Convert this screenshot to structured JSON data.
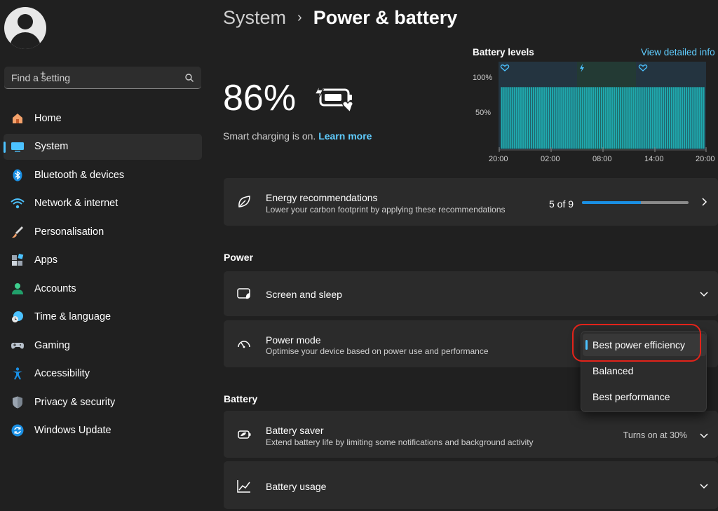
{
  "sidebar": {
    "search_placeholder": "Find a setting",
    "items": [
      {
        "label": "Home",
        "icon": "home-icon"
      },
      {
        "label": "System",
        "icon": "system-icon",
        "active": true
      },
      {
        "label": "Bluetooth & devices",
        "icon": "bluetooth-icon"
      },
      {
        "label": "Network & internet",
        "icon": "wifi-icon"
      },
      {
        "label": "Personalisation",
        "icon": "brush-icon"
      },
      {
        "label": "Apps",
        "icon": "apps-icon"
      },
      {
        "label": "Accounts",
        "icon": "accounts-icon"
      },
      {
        "label": "Time & language",
        "icon": "clock-globe-icon"
      },
      {
        "label": "Gaming",
        "icon": "gamepad-icon"
      },
      {
        "label": "Accessibility",
        "icon": "accessibility-icon"
      },
      {
        "label": "Privacy & security",
        "icon": "shield-icon"
      },
      {
        "label": "Windows Update",
        "icon": "update-icon"
      }
    ]
  },
  "breadcrumb": {
    "parent": "System",
    "separator": "›",
    "title": "Power & battery"
  },
  "battery": {
    "percent_text": "86%",
    "smart_text": "Smart charging is on.",
    "learn_more": "Learn more"
  },
  "levels": {
    "title": "Battery levels",
    "link": "View detailed info",
    "y_labels": [
      "100%",
      "50%"
    ],
    "x_labels": [
      "20:00",
      "02:00",
      "08:00",
      "14:00",
      "20:00"
    ]
  },
  "chart_data": {
    "type": "bar",
    "title": "Battery levels",
    "ylim": [
      0,
      100
    ],
    "y_ticks": [
      "100%",
      "50%"
    ],
    "x_ticks": [
      "20:00",
      "02:00",
      "08:00",
      "14:00",
      "20:00"
    ],
    "values": [
      86,
      86,
      86,
      86,
      86,
      86,
      86,
      86,
      86,
      86,
      86,
      86,
      86,
      86,
      86,
      86,
      86,
      86,
      86,
      86,
      86,
      86,
      86,
      86,
      86,
      86,
      86,
      86,
      86,
      86,
      86,
      86,
      86,
      86,
      86,
      86,
      86,
      86,
      86,
      86,
      86,
      86,
      86,
      86,
      86,
      86,
      86,
      86,
      86,
      86,
      86,
      86,
      86,
      86,
      86,
      86,
      86,
      86,
      86,
      86,
      86,
      86,
      86,
      86,
      86,
      86,
      86,
      86,
      86,
      86,
      86,
      86,
      86,
      86,
      86,
      86,
      86,
      86,
      86,
      86,
      86,
      86,
      86,
      86,
      86,
      86,
      86,
      86,
      86,
      86,
      86,
      86,
      86,
      86,
      86,
      86
    ]
  },
  "energy": {
    "title": "Energy recommendations",
    "subtitle": "Lower your carbon footprint by applying these recommendations",
    "progress_text": "5 of 9",
    "progress": 0.555
  },
  "power_section": "Power",
  "screen_sleep": {
    "title": "Screen and sleep"
  },
  "power_mode": {
    "title": "Power mode",
    "subtitle": "Optimise your device based on power use and performance",
    "options": [
      "Best power efficiency",
      "Balanced",
      "Best performance"
    ],
    "selected": "Best power efficiency"
  },
  "battery_section": "Battery",
  "battery_saver": {
    "title": "Battery saver",
    "subtitle": "Extend battery life by limiting some notifications and background activity",
    "value": "Turns on at 30%"
  },
  "battery_usage": {
    "title": "Battery usage"
  },
  "colors": {
    "accent": "#4cc2ff",
    "link": "#60cdff",
    "bars": "#1fa8ad",
    "annotation": "#e2231a"
  }
}
